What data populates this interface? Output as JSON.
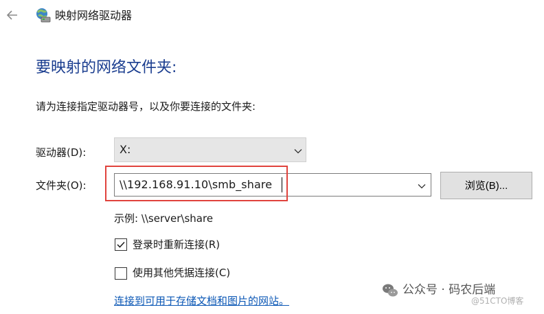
{
  "window": {
    "title": "映射网络驱动器",
    "back_icon": "back-arrow-icon",
    "app_icon": "network-drive-icon"
  },
  "main": {
    "heading": "要映射的网络文件夹:",
    "instruction": "请为连接指定驱动器号，以及你要连接的文件夹:",
    "drive": {
      "label": "驱动器(D):",
      "selected": "X:"
    },
    "folder": {
      "label": "文件夹(O):",
      "value": "\\\\192.168.91.10\\smb_share"
    },
    "browse_label": "浏览(B)...",
    "example": "示例: \\\\server\\share",
    "options": {
      "reconnect": {
        "label": "登录时重新连接(R)",
        "checked": true
      },
      "credentials": {
        "label": "使用其他凭据连接(C)",
        "checked": false
      }
    },
    "storage_link": "连接到可用于存储文档和图片的网站。"
  },
  "watermark": {
    "brand": "公众号 · 码农后端",
    "source": "@51CTO博客"
  },
  "colors": {
    "heading": "#1a3d8f",
    "link": "#0b57b5",
    "highlight": "#e0423c"
  }
}
